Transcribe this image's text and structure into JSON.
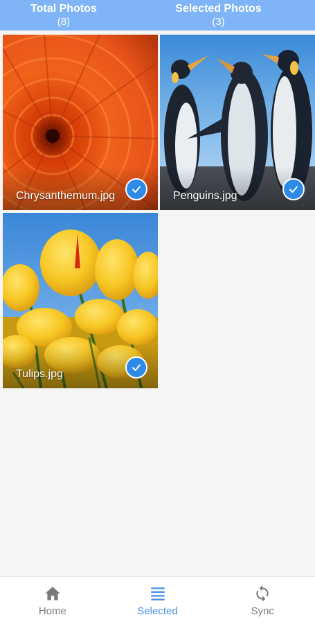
{
  "header": {
    "total_label": "Total Photos",
    "total_count": "(8)",
    "selected_label": "Selected Photos",
    "selected_count": "(3)"
  },
  "photos": [
    {
      "name": "Chrysanthemum.jpg",
      "selected": true
    },
    {
      "name": "Penguins.jpg",
      "selected": true
    },
    {
      "name": "Tulips.jpg",
      "selected": true
    }
  ],
  "tabs": [
    {
      "label": "Home",
      "icon": "home-icon"
    },
    {
      "label": "Selected",
      "icon": "list-icon",
      "active": true
    },
    {
      "label": "Sync",
      "icon": "sync-icon"
    }
  ],
  "colors": {
    "header_bg": "#7fb4f7",
    "check_bg": "#2d8ae6",
    "tab_active": "#4a90e2",
    "tab_inactive": "#7a7a7a"
  }
}
